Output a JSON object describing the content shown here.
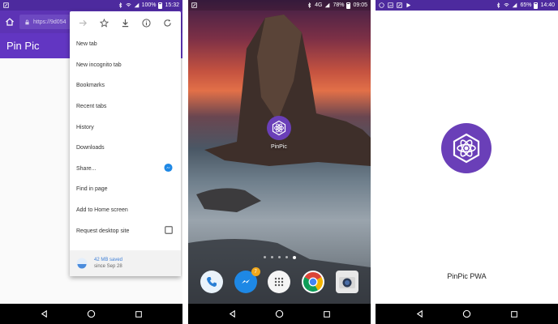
{
  "colors": {
    "primary": "#6236c2",
    "status_bar": "#4d2a9e",
    "accent_blue": "#3f7fd6"
  },
  "phone1": {
    "status": {
      "battery": "100%",
      "time": "15:32"
    },
    "url": "https://9d054",
    "app_title": "Pin Pic",
    "menu": {
      "icons": [
        "forward-icon",
        "star-icon",
        "download-icon",
        "info-icon",
        "refresh-icon"
      ],
      "items": [
        {
          "label": "New tab"
        },
        {
          "label": "New incognito tab"
        },
        {
          "label": "Bookmarks"
        },
        {
          "label": "Recent tabs"
        },
        {
          "label": "History"
        },
        {
          "label": "Downloads"
        },
        {
          "label": "Share..."
        },
        {
          "label": "Find in page"
        },
        {
          "label": "Add to Home screen"
        },
        {
          "label": "Request desktop site"
        }
      ],
      "footer": {
        "saved": "42 MB saved",
        "since": "since Sep 28"
      }
    }
  },
  "phone2": {
    "status": {
      "network": "4G",
      "battery": "78%",
      "time": "09:05"
    },
    "home_icon_label": "PinPic",
    "dock_apps": [
      "phone-app-icon",
      "messenger-app-icon",
      "app-drawer-icon",
      "chrome-app-icon",
      "camera-app-icon"
    ],
    "messenger_badge": "7"
  },
  "phone3": {
    "status": {
      "battery": "65%",
      "time": "14:40"
    },
    "splash_label": "PinPic PWA"
  }
}
